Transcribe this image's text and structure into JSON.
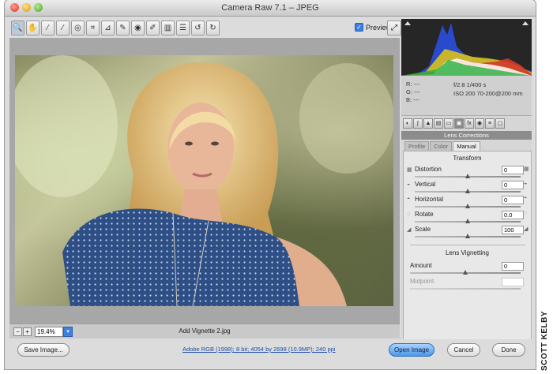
{
  "window": {
    "title": "Camera Raw 7.1  –  JPEG"
  },
  "toolbar": {
    "tools": [
      {
        "icon": "zoom-icon",
        "glyph": "🔍"
      },
      {
        "icon": "hand-icon",
        "glyph": "✋"
      },
      {
        "icon": "white-balance-icon",
        "glyph": "⁄"
      },
      {
        "icon": "color-sampler-icon",
        "glyph": "⁄"
      },
      {
        "icon": "targeted-adjustment-icon",
        "glyph": "◎"
      },
      {
        "icon": "crop-icon",
        "glyph": "⌗"
      },
      {
        "icon": "straighten-icon",
        "glyph": "⊿"
      },
      {
        "icon": "spot-removal-icon",
        "glyph": "✎"
      },
      {
        "icon": "red-eye-icon",
        "glyph": "◉"
      },
      {
        "icon": "adjustment-brush-icon",
        "glyph": "✐"
      },
      {
        "icon": "graduated-filter-icon",
        "glyph": "▥"
      },
      {
        "icon": "preferences-icon",
        "glyph": "☰"
      },
      {
        "icon": "rotate-left-icon",
        "glyph": "↺"
      },
      {
        "icon": "rotate-right-icon",
        "glyph": "↻"
      }
    ],
    "preview_label": "Preview",
    "preview_checked": true
  },
  "status": {
    "zoom": "19.4%",
    "filename": "Add Vignette 2.jpg"
  },
  "metadata": {
    "r": "R:  ---",
    "g": "G:  ---",
    "b": "B:  ---",
    "aperture_shutter": "f/2.8   1/400 s",
    "iso_lens": "ISO 200   70-200@200 mm"
  },
  "panel": {
    "title": "Lens Corrections",
    "tabs": [
      {
        "label": "Profile",
        "selected": false
      },
      {
        "label": "Color",
        "selected": false
      },
      {
        "label": "Manual",
        "selected": true
      }
    ],
    "transform_heading": "Transform",
    "transform": [
      {
        "label": "Distortion",
        "value": "0",
        "fraction": 0.5
      },
      {
        "label": "Vertical",
        "value": "0",
        "fraction": 0.5
      },
      {
        "label": "Horizontal",
        "value": "0",
        "fraction": 0.5
      },
      {
        "label": "Rotate",
        "value": "0.0",
        "fraction": 0.5
      },
      {
        "label": "Scale",
        "value": "100",
        "fraction": 0.5
      }
    ],
    "vignetting_heading": "Lens Vignetting",
    "amount_label": "Amount",
    "amount_value": "0",
    "midpoint_label": "Midpoint",
    "midpoint_value": ""
  },
  "bottom": {
    "save_label": "Save Image...",
    "workflow_link": "Adobe RGB (1998); 8 bit; 4054 by 2698 (10.9MP); 240 ppi",
    "open_label": "Open Image",
    "cancel_label": "Cancel",
    "done_label": "Done"
  },
  "credit": "SCOTT KELBY",
  "colors": {
    "accent": "#4a98e8",
    "panel_header": "#8c8c8c"
  }
}
